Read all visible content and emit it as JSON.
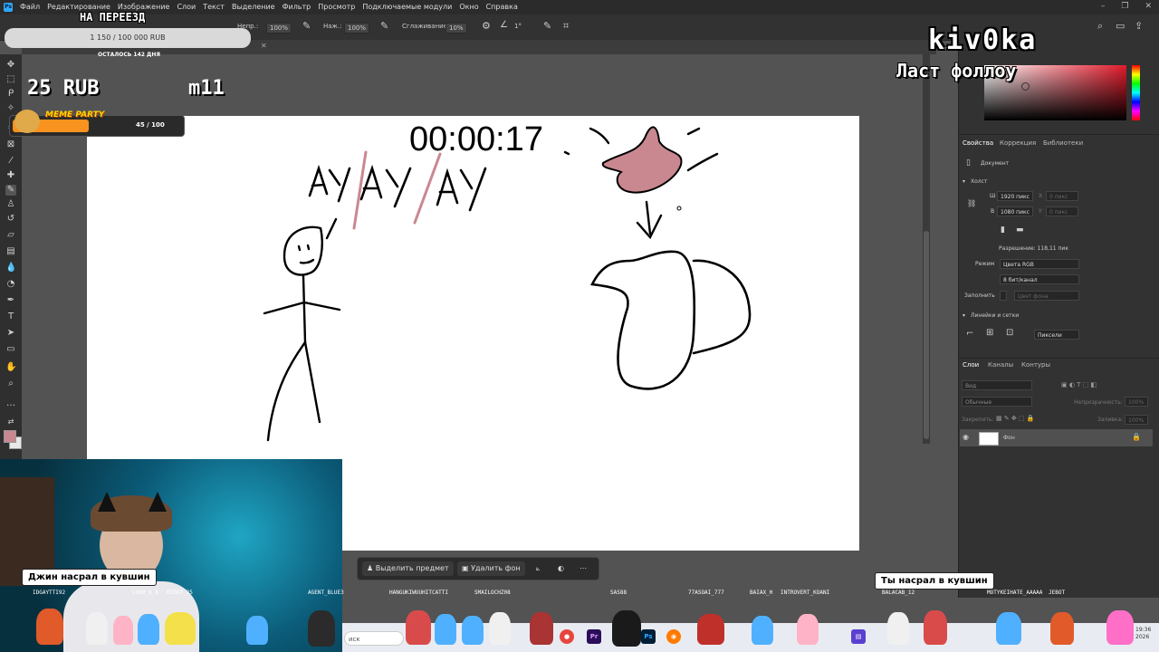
{
  "app": {
    "logo": "Ps",
    "menu": [
      "Файл",
      "Редактирование",
      "Изображение",
      "Слои",
      "Текст",
      "Выделение",
      "Фильтр",
      "Просмотр",
      "Подключаемые модули",
      "Окно",
      "Справка"
    ]
  },
  "options_bar": {
    "opacity_label": "Непр.:",
    "opacity_value": "100%",
    "pressure_label": "Наж.:",
    "pressure_value": "100%",
    "smoothing_label": "Сглаживание:",
    "smoothing_value": "10%",
    "angle_value": "1°"
  },
  "overlays": {
    "goal_title": "НА ПЕРЕЕЗД",
    "goal_progress": "1 150 / 100 000 RUB",
    "goal_fraction": 0.0115,
    "days_left": "ОСТАЛОСЬ 142 ДНЯ",
    "rub_amount": "25 RUB",
    "m11": "m11",
    "meme_title": "MEME PARTY",
    "meme_count": "45 / 100",
    "meme_fraction": 0.45,
    "streamer_name": "kiv0ka",
    "last_follow": "Ласт фоллоу"
  },
  "canvas": {
    "timer": "00:00:17",
    "handwriting": [
      "АУ",
      "АУ",
      "АУ"
    ]
  },
  "right_panel": {
    "tabs_top": [
      "Свойства",
      "Коррекция",
      "Библиотеки"
    ],
    "document_label": "Документ",
    "canvas_section": "Холст",
    "width_label": "Ш",
    "width_value": "1920 пикс",
    "height_label": "В",
    "height_value": "1080 пикс",
    "x_label": "X",
    "x_placeholder": "0 пикс",
    "y_label": "Y",
    "y_placeholder": "0 пикс",
    "resolution": "Разрешение: 118,11 пик",
    "mode_label": "Режим",
    "mode_value": "Цвета RGB",
    "depth_value": "8 бит/канал",
    "fill_label": "Заполнить",
    "fill_value": "Цвет фона",
    "rulers_section": "Линейки и сетки",
    "units_value": "Пиксели",
    "layer_tabs": [
      "Слои",
      "Каналы",
      "Контуры"
    ],
    "layer_search": "Вид",
    "blend_mode": "Обычные",
    "opacity_label": "Непрозрачность:",
    "opacity_value": "100%",
    "lock_label": "Закрепить:",
    "fill_label2": "Заливка:",
    "fill_value2": "100%",
    "layer_name": "Фон"
  },
  "context_bar": {
    "select_subject": "Выделить предмет",
    "remove_bg": "Удалить фон"
  },
  "captions": {
    "webcam": "Джин насрал в кувшин",
    "right": "Ты насрал в кувшин"
  },
  "nicknames": [
    "IDGAYTTI92",
    "LOKH_8_8",
    "MIDOI_25",
    "AGENT_BLUE3",
    "HANGUKIWUUHITCATTI",
    "SMAILOCHZ08",
    "SAS88",
    "77ASOAI_777",
    "BAIAX_H",
    "INTROVERT_KOANI",
    "BALACAB_12",
    "MOTYKEIHATE_AAAAA",
    "JEBOT"
  ],
  "taskbar": {
    "search_placeholder": "иск",
    "time": "19:36",
    "date": "2026"
  },
  "colors": {
    "accent": "#31a8ff",
    "foreground_swatch": "#c98890",
    "drawing_pink": "#c98890",
    "meme_orange": "#f7931e"
  }
}
